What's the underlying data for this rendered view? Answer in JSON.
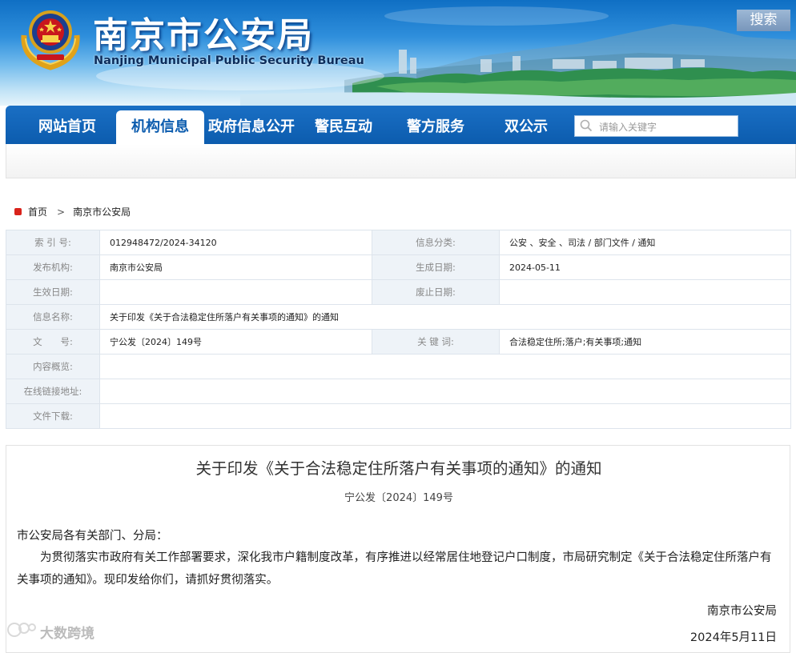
{
  "header": {
    "title": "南京市公安局",
    "subtitle": "Nanjing Municipal Public Security Bureau"
  },
  "nav": {
    "items": [
      {
        "label": "网站首页",
        "active": false
      },
      {
        "label": "机构信息",
        "active": true
      },
      {
        "label": "政府信息公开",
        "active": false
      },
      {
        "label": "警民互动",
        "active": false
      },
      {
        "label": "警方服务",
        "active": false
      },
      {
        "label": "双公示",
        "active": false
      }
    ],
    "search_placeholder": "请输入关键字",
    "search_button": "搜索"
  },
  "breadcrumb": {
    "home": "首页",
    "current": "南京市公安局"
  },
  "info": {
    "index_label": "索 引 号:",
    "index_value": "012948472/2024-34120",
    "category_label": "信息分类:",
    "category_value": "公安 、安全 、司法 / 部门文件 / 通知",
    "publisher_label": "发布机构:",
    "publisher_value": "南京市公安局",
    "created_label": "生成日期:",
    "created_value": "2024-05-11",
    "effective_label": "生效日期:",
    "effective_value": "",
    "expire_label": "废止日期:",
    "expire_value": "",
    "name_label": "信息名称:",
    "name_value": "关于印发《关于合法稳定住所落户有关事项的通知》的通知",
    "docno_label": "文　　号:",
    "docno_value": "宁公发〔2024〕149号",
    "keywords_label": "关 键 词:",
    "keywords_value": "合法稳定住所;落户;有关事项;通知",
    "summary_label": "内容概览:",
    "summary_value": "",
    "link_label": "在线链接地址:",
    "link_value": "",
    "download_label": "文件下载:",
    "download_value": ""
  },
  "article": {
    "title": "关于印发《关于合法稳定住所落户有关事项的通知》的通知",
    "doc_no": "宁公发〔2024〕149号",
    "greeting": "市公安局各有关部门、分局：",
    "body": "为贯彻落实市政府有关工作部署要求，深化我市户籍制度改革，有序推进以经常居住地登记户口制度，市局研究制定《关于合法稳定住所落户有关事项的通知》。现印发给你们，请抓好贯彻落实。",
    "issuer": "南京市公安局",
    "date": "2024年5月11日"
  },
  "watermark": "大数跨境",
  "colors": {
    "nav_blue": "#0c5cae",
    "label_bg": "#eef3f8",
    "accent_red": "#d9231b"
  }
}
